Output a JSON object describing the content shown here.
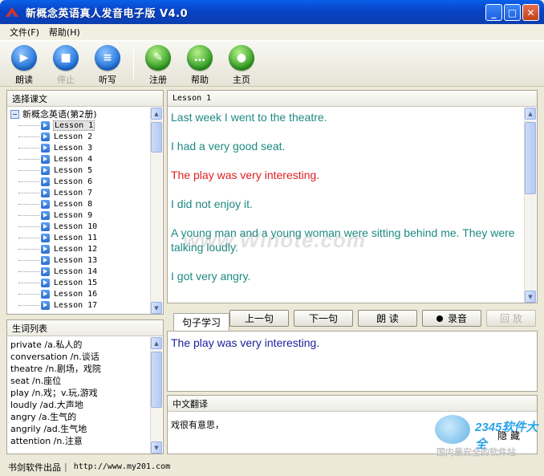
{
  "window": {
    "title": "新概念英语真人发音电子版 V4.0",
    "min_label": "_",
    "max_label": "□",
    "close_label": "✕"
  },
  "menu": [
    "文件(F)",
    "帮助(H)"
  ],
  "toolbar": {
    "read": "朗读",
    "stop": "停止",
    "dictation": "听写",
    "register": "注册",
    "help": "帮助",
    "home": "主页"
  },
  "lesson_panel": {
    "title": "选择课文",
    "root": "新概念英语(第2册)",
    "lessons": [
      "Lesson 1",
      "Lesson 2",
      "Lesson 3",
      "Lesson 4",
      "Lesson 5",
      "Lesson 6",
      "Lesson 7",
      "Lesson 8",
      "Lesson 9",
      "Lesson 10",
      "Lesson 11",
      "Lesson 12",
      "Lesson 13",
      "Lesson 14",
      "Lesson 15",
      "Lesson 16",
      "Lesson 17"
    ],
    "selected": "Lesson 1"
  },
  "vocab_panel": {
    "title": "生词列表",
    "items": [
      "private /a.私人的",
      "conversation /n.谈话",
      "theatre /n.剧场，戏院",
      "seat /n.座位",
      "play /n.戏；v.玩,游戏",
      "loudly /ad.大声地",
      "angry /a.生气的",
      "angrily /ad.生气地",
      "attention /n.注意"
    ]
  },
  "text_panel": {
    "title": "Lesson 1",
    "sentences": [
      "Last week I went to the theatre.",
      "I had a very good seat.",
      "The play was very interesting.",
      "I did not enjoy it.",
      "A young man and a young woman were sitting behind me. They were talking loudly.",
      "I got very angry."
    ],
    "current_index": 2
  },
  "study": {
    "tab": "句子学习",
    "prev": "上一句",
    "next": "下一句",
    "read": "朗  读",
    "record": "录音",
    "replay": "回  放",
    "sentence": "The play was very interesting."
  },
  "translation": {
    "title": "中文翻译",
    "text": "戏很有意思，",
    "hide": "隐藏"
  },
  "status": {
    "publisher": "书剑软件出品",
    "separator": "|",
    "url": "http://www.my201.com"
  },
  "watermark": "www.Winote.com",
  "brand": {
    "logo": "2345软件大全",
    "slogan": "国内最安全的软件站"
  },
  "colors": {
    "title_bar": "#0a4fd8",
    "sentence": "#1e8a82",
    "current_sentence": "#e02020",
    "study_sentence": "#2020a0"
  }
}
